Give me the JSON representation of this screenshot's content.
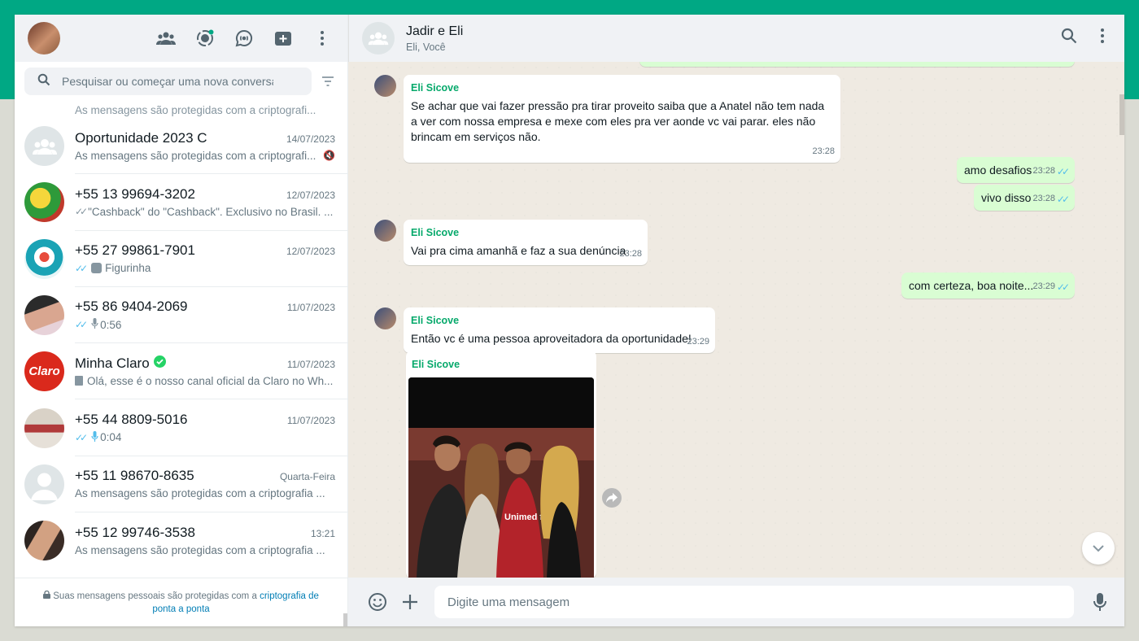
{
  "colors": {
    "accent": "#00a884",
    "outgoing_bubble": "#d9fdd3",
    "sender_name": "#06a96b",
    "read_tick": "#53bdeb"
  },
  "sidebar": {
    "header": {
      "icons": [
        "community-icon",
        "status-icon",
        "channels-icon",
        "new-chat-icon",
        "menu-icon"
      ]
    },
    "search": {
      "placeholder": "Pesquisar ou começar uma nova conversa"
    },
    "partial_preview": "As mensagens são protegidas com a criptografi...",
    "chats": [
      {
        "name": "Oportunidade 2023 C",
        "time": "14/07/2023",
        "preview": "As mensagens são protegidas com a criptografi...",
        "muted": true
      },
      {
        "name": "+55 13 99694-3202",
        "time": "12/07/2023",
        "preview": "\"Cashback\" do \"Cashback\". Exclusivo no Brasil. ...",
        "tick": "grey"
      },
      {
        "name": "+55 27 99861-7901",
        "time": "12/07/2023",
        "preview": "Figurinha",
        "tick": "blue",
        "icon": "sticker-icon"
      },
      {
        "name": "+55 86 9404-2069",
        "time": "11/07/2023",
        "preview": "0:56",
        "tick": "blue",
        "icon": "mic-icon"
      },
      {
        "name": "Minha Claro",
        "time": "11/07/2023",
        "preview": "Olá, esse é o nosso canal oficial da Claro no Wh...",
        "verified": true,
        "icon": "document-icon",
        "logo_text": "Claro"
      },
      {
        "name": "+55 44 8809-5016",
        "time": "11/07/2023",
        "preview": "0:04",
        "tick": "blue",
        "icon": "mic-icon"
      },
      {
        "name": "+55 11 98670-8635",
        "time": "Quarta-Feira",
        "preview": "As mensagens são protegidas com a criptografia ..."
      },
      {
        "name": "+55 12 99746-3538",
        "time": "13:21",
        "preview": "As mensagens são protegidas com a criptografia ..."
      }
    ],
    "footer": {
      "text": "Suas mensagens pessoais são protegidas com a ",
      "link": "criptografia de ponta a ponta"
    }
  },
  "chat": {
    "title": "Jadir e Eli",
    "subtitle": "Eli, Você",
    "messages": [
      {
        "dir": "in",
        "sender": "Eli Sicove",
        "text": "Se achar que vai fazer pressão pra tirar proveito saiba que a Anatel não tem nada a ver com nossa empresa e mexe com eles pra ver aonde vc vai parar. eles não brincam em serviços não.",
        "time": "23:28"
      },
      {
        "dir": "out",
        "text": "amo desafios",
        "time": "23:28"
      },
      {
        "dir": "out",
        "text": "vivo disso",
        "time": "23:28"
      },
      {
        "dir": "in",
        "sender": "Eli Sicove",
        "text": "Vai pra cima amanhã e faz a sua denúncia",
        "time": "23:28"
      },
      {
        "dir": "out",
        "text": "com certeza, boa noite...",
        "time": "23:29"
      },
      {
        "dir": "in",
        "sender": "Eli Sicove",
        "text": "Então vc é uma pessoa aproveitadora da oportunidade!",
        "time": "23:29"
      },
      {
        "dir": "in",
        "sender": "Eli Sicove",
        "type": "image",
        "shirt_text": "Unimed ft"
      }
    ]
  },
  "composer": {
    "placeholder": "Digite uma mensagem"
  }
}
